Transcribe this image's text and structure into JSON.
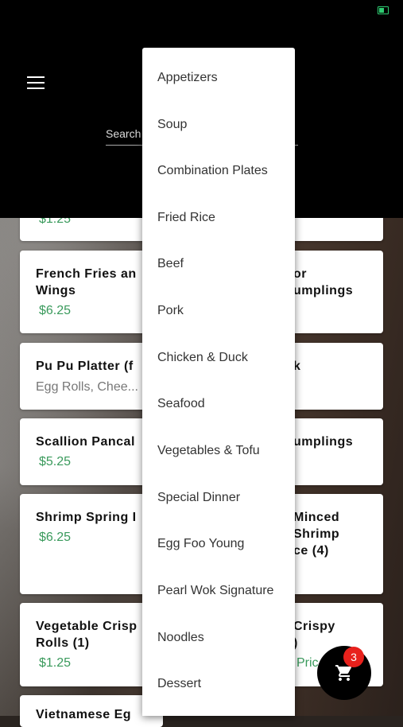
{
  "colors": {
    "price": "#3a9a5c",
    "badge": "#e8211c",
    "header": "#000000",
    "battery": "#2ecc71"
  },
  "header": {
    "search_placeholder": "Search"
  },
  "cards_left": [
    {
      "price": "$1.25"
    },
    {
      "name": "French Fries an\nWings",
      "price": "$6.25"
    },
    {
      "name": "Pu Pu Platter (f",
      "desc": "Egg Rolls, Chee..."
    },
    {
      "name": "Scallion Pancal",
      "price": "$5.25"
    },
    {
      "name": "Shrimp Spring I",
      "price": "$6.25"
    },
    {
      "name": "Vegetable Crisp\nRolls (1)",
      "price": "$1.25"
    },
    {
      "name": "Vietnamese Eg"
    }
  ],
  "cards_right": [
    {
      "name": "or\numplings"
    },
    {
      "name": "k"
    },
    {
      "name": "umplings"
    },
    {
      "name": "Minced\nShrimp\nce (4)"
    },
    {
      "name": "Crispy\n)",
      "price": "Pric"
    }
  ],
  "dropdown": {
    "items": [
      "Appetizers",
      "Soup",
      "Combination Plates",
      "Fried Rice",
      "Beef",
      "Pork",
      "Chicken & Duck",
      "Seafood",
      "Vegetables & Tofu",
      "Special Dinner",
      "Egg Foo Young",
      "Pearl Wok Signature",
      "Noodles",
      "Dessert"
    ]
  },
  "cart": {
    "count": "3",
    "icon": "cart-icon"
  }
}
